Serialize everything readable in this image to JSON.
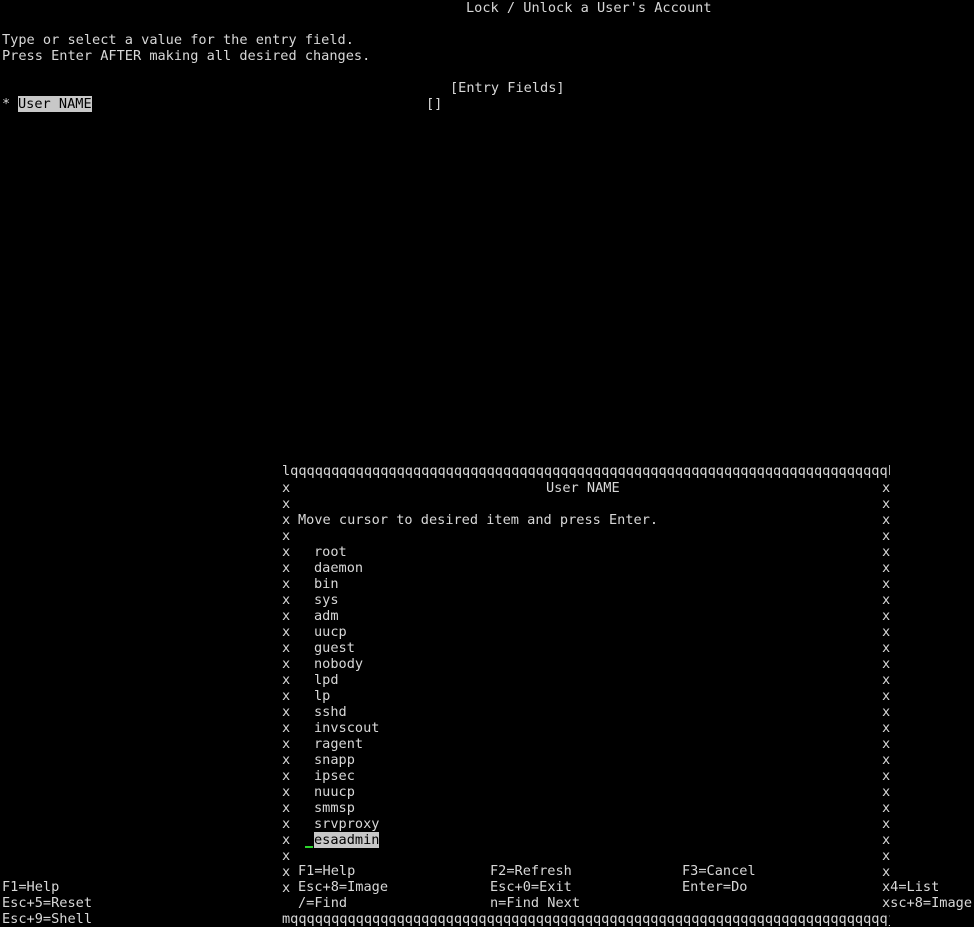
{
  "screen": {
    "title": "Lock / Unlock a User's Account",
    "instructions": [
      "Type or select a value for the entry field.",
      "Press Enter AFTER making all desired changes."
    ],
    "entry_fields_header": "[Entry Fields]",
    "field": {
      "required_marker": "*",
      "label": "User NAME",
      "value": "[]"
    },
    "function_keys": {
      "f1": "F1=Help",
      "esc5": "Esc+5=Reset",
      "esc9": "Esc+9=Shell",
      "f4_partial": "x4=List",
      "esc8_partial": "xsc+8=Image"
    }
  },
  "popup": {
    "top_border": "lqqqqqqqqqqqqqqqqqqqqqqqqqqqqqqqqqqqqqqqqqqqqqqqqqqqqqqqqqqqqqqqqqqqqqqqqqk",
    "bottom_border": "mqqqqqqqqqqqqqqqqqqqqqqqqqqqqqqqqqqqqqqqqqqqqqqqqqqqqqqqqqqqqqqqqqqqqqqqqqj",
    "side_char": "x",
    "title": "User NAME",
    "instruction": "Move cursor to desired item and press Enter.",
    "items": [
      "root",
      "daemon",
      "bin",
      "sys",
      "adm",
      "uucp",
      "guest",
      "nobody",
      "lpd",
      "lp",
      "sshd",
      "invscout",
      "ragent",
      "snapp",
      "ipsec",
      "nuucp",
      "smmsp",
      "srvproxy",
      "esaadmin"
    ],
    "selected_index": 18,
    "keys": {
      "f1": "F1=Help",
      "f2": "F2=Refresh",
      "f3": "F3=Cancel",
      "esc8": "Esc+8=Image",
      "esc0": "Esc+0=Exit",
      "enter": "Enter=Do",
      "find": "/=Find",
      "find_next": "n=Find Next"
    }
  }
}
